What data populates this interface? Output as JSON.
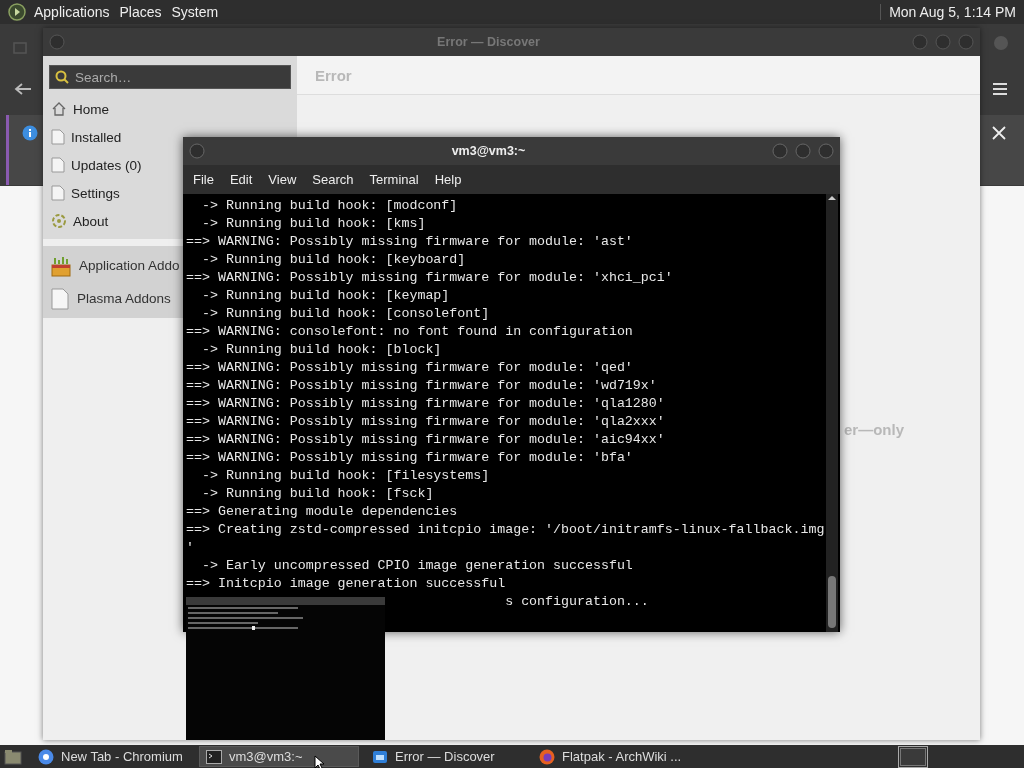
{
  "top_panel": {
    "menus": [
      "Applications",
      "Places",
      "System"
    ],
    "clock": "Mon Aug 5, 1:14 PM"
  },
  "discover": {
    "title": "Error — Discover",
    "search": {
      "placeholder": "Search…"
    },
    "page_title": "Error",
    "message_fragment": "er—only",
    "nav": [
      {
        "label": "Home",
        "kind": "home"
      },
      {
        "label": "Installed",
        "kind": "page"
      },
      {
        "label": "Updates (0)",
        "kind": "page"
      },
      {
        "label": "Settings",
        "kind": "page"
      },
      {
        "label": "About",
        "kind": "about"
      }
    ],
    "addons": [
      {
        "label": "Application Addo",
        "kind": "box"
      },
      {
        "label": "Plasma Addons",
        "kind": "page"
      }
    ]
  },
  "terminal": {
    "title": "vm3@vm3:~",
    "menu": [
      "File",
      "Edit",
      "View",
      "Search",
      "Terminal",
      "Help"
    ],
    "lines": [
      "  -> Running build hook: [modconf]",
      "  -> Running build hook: [kms]",
      "==> WARNING: Possibly missing firmware for module: 'ast'",
      "  -> Running build hook: [keyboard]",
      "==> WARNING: Possibly missing firmware for module: 'xhci_pci'",
      "  -> Running build hook: [keymap]",
      "  -> Running build hook: [consolefont]",
      "==> WARNING: consolefont: no font found in configuration",
      "  -> Running build hook: [block]",
      "==> WARNING: Possibly missing firmware for module: 'qed'",
      "==> WARNING: Possibly missing firmware for module: 'wd719x'",
      "==> WARNING: Possibly missing firmware for module: 'qla1280'",
      "==> WARNING: Possibly missing firmware for module: 'qla2xxx'",
      "==> WARNING: Possibly missing firmware for module: 'aic94xx'",
      "==> WARNING: Possibly missing firmware for module: 'bfa'",
      "  -> Running build hook: [filesystems]",
      "  -> Running build hook: [fsck]",
      "==> Generating module dependencies",
      "==> Creating zstd-compressed initcpio image: '/boot/initramfs-linux-fallback.img",
      "'",
      "  -> Early uncompressed CPIO image generation successful",
      "==> Initcpio image generation successful"
    ],
    "covered_line": "s configuration..."
  },
  "taskbar": {
    "tasks": [
      {
        "label": "New Tab - Chromium",
        "kind": "browser",
        "selected": false
      },
      {
        "label": "vm3@vm3:~",
        "kind": "terminal",
        "selected": true
      },
      {
        "label": "Error — Discover",
        "kind": "discover",
        "selected": false
      },
      {
        "label": "Flatpak - ArchWiki ...",
        "kind": "firefox",
        "selected": false
      }
    ]
  }
}
